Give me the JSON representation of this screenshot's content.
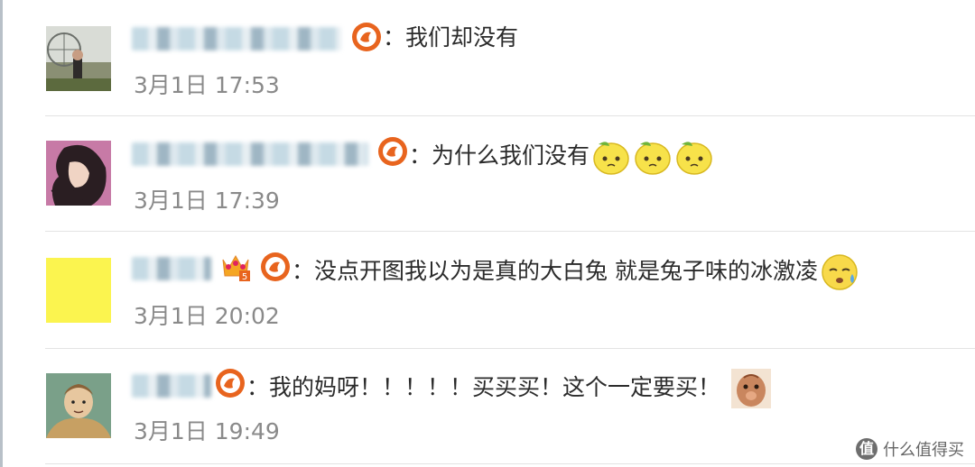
{
  "comments": [
    {
      "text": "我们却没有",
      "time": "3月1日 17:53",
      "emoji_count": 0
    },
    {
      "text": "为什么我们没有",
      "time": "3月1日 17:39",
      "emoji_count": 3
    },
    {
      "text": "没点开图我以为是真的大白兔 就是兔子味的冰激凌",
      "time": "3月1日 20:02",
      "emoji_count": 1
    },
    {
      "text": "我的妈呀！！！！！买买买！这个一定要买！",
      "time": "3月1日 19:49",
      "emoji_count": 1
    }
  ],
  "separator": "：",
  "watermark": {
    "logo": "值",
    "text": "什么值得买"
  },
  "colors": {
    "background": "#ffffff",
    "text": "#2b2b2b",
    "time": "#8a8a8a",
    "divider": "#e3e3e3",
    "badge": "#e8641e"
  }
}
